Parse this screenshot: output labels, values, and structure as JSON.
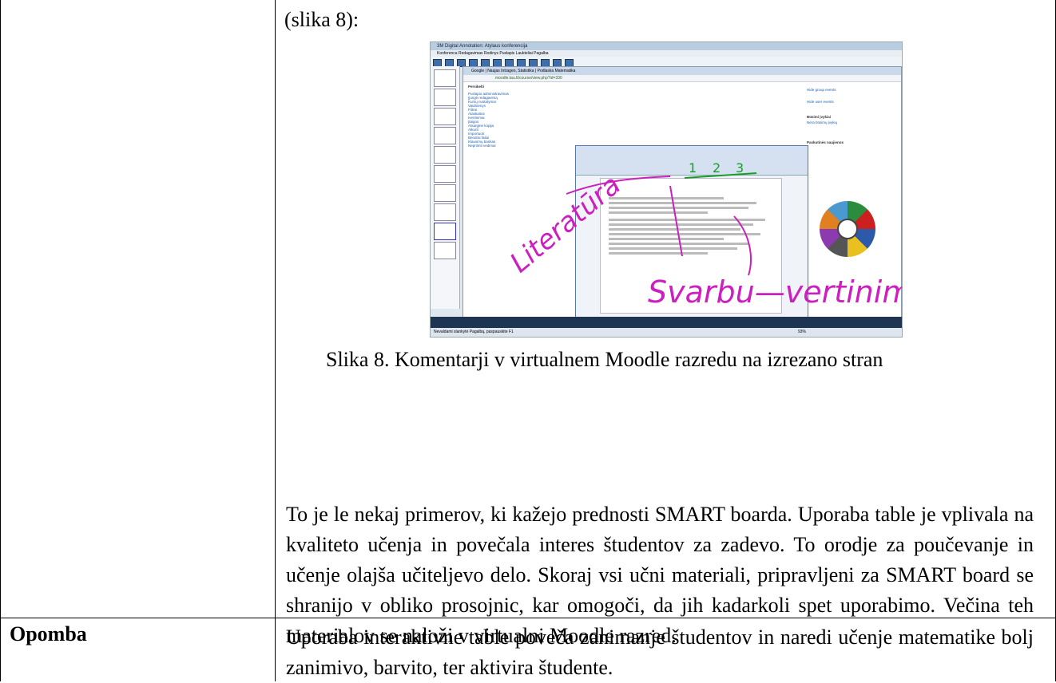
{
  "figure": {
    "ref_text": "(slika 8):",
    "caption": "Slika 8. Komentarji v virtualnem Moodle razredu na izrezano stran"
  },
  "screenshot": {
    "window_title": "3M Digital Annotation: Atylaus konferencija",
    "menu": "Konferenca Redagavimas Rodinys Puslapis Laukteliai Pagalba",
    "tabs": "Google | Naujas Intrageo, Statistika | Podlaska Matematika",
    "url": "moodle.tau.lt/course/view.php?id=330",
    "side_heading": "Persikelti",
    "side_items": [
      "Puslapio administravimas",
      "Įjungti redagavimą",
      "Kursų nustatymai",
      "Vaidmenys",
      "Filtrai",
      "Ataskaitos",
      "Ivertinimai",
      "Įtaigos",
      "Atsarginė kopija",
      "Atkurti",
      "Importuoti",
      "Bendrai failai",
      "Klausimų bankas",
      "Nepriimti vedimai"
    ],
    "right_items": [
      "Hide group events",
      "Hide user events",
      "Būsimi įvykiai",
      "Nėra būsimų įvykių",
      "Paskutinės naujienos"
    ],
    "handwriting": [
      "Literatūra",
      "Svarbu—vertinimas",
      "1",
      "2",
      "3"
    ],
    "status_text": "Nevaldami slankytė Pagalbą, paspauskite F1",
    "status_zoom": "93%"
  },
  "body_paragraph": "To je le nekaj primerov, ki kažejo prednosti SMART boarda. Uporaba table je vplivala na kvaliteto učenja in povečala interes študentov za zadevo. To orodje za poučevanje in učenje olajša učiteljevo delo. Skoraj vsi učni materiali, pripravljeni za SMART board se shranijo v obliko prosojnic, kar omogoči, da jih kadarkoli spet uporabimo. Večina teh materialov se naloži v virtualni Moodle razred.",
  "note": {
    "label": "Opomba",
    "text": "Uporaba interaktivne table poveča zanimanje študentov in naredi učenje matematike bolj zanimivo, barvito, ter aktivira študente."
  }
}
